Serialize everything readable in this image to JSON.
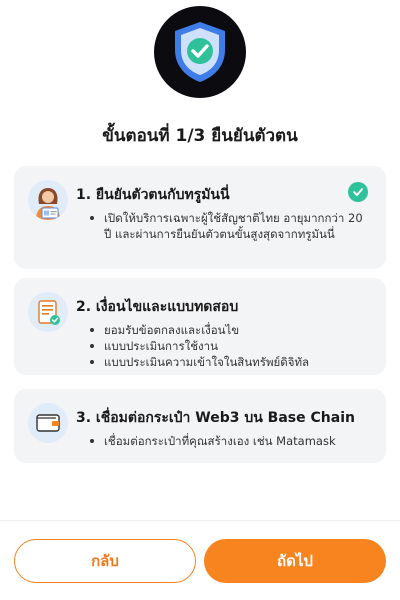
{
  "header": {
    "icon": "shield-check-icon",
    "title": "ขั้นตอนที่ 1/3 ยืนยันตัวตน"
  },
  "steps": [
    {
      "title": "1. ยืนยันตัวตนกับทรูมันนี่",
      "icon": "person-id-card-icon",
      "completed": true,
      "bullets": [
        "เปิดให้บริการเฉพาะผู้ใช้สัญชาติไทย อายุมากกว่า 20 ปี และผ่านการยืนยันตัวตนขั้นสูงสุดจากทรูมันนี่"
      ]
    },
    {
      "title": "2. เงื่อนไขและแบบทดสอบ",
      "icon": "document-check-icon",
      "completed": false,
      "bullets": [
        "ยอมรับข้อตกลงและเงื่อนไข",
        "แบบประเมินการใช้งาน",
        "แบบประเมินความเข้าใจในสินทรัพย์ดิจิทัล"
      ]
    },
    {
      "title": "3. เชื่อมต่อกระเป๋า Web3 บน Base Chain",
      "icon": "wallet-icon",
      "completed": false,
      "bullets": [
        "เชื่อมต่อกระเป๋าที่คุณสร้างเอง เช่น Matamask"
      ]
    }
  ],
  "footer": {
    "back_label": "กลับ",
    "next_label": "ถัดไป"
  },
  "colors": {
    "accent": "#f7841f",
    "success": "#2fc29a",
    "card_bg": "#f3f4f6",
    "shield_blue": "#3e7ce8"
  }
}
